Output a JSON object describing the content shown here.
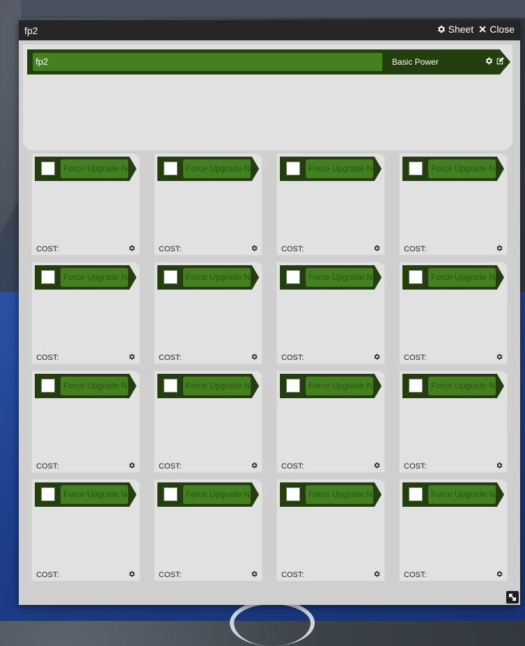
{
  "window": {
    "title": "fp2",
    "sheet_label": "Sheet",
    "close_label": "Close"
  },
  "power": {
    "name": "fp2",
    "type": "Basic Power"
  },
  "upgrades": {
    "placeholder": "Force Upgrade Name",
    "cost_label": "COST:",
    "rows": 4,
    "columns": 4
  },
  "colors": {
    "header_dark_green": "#243f0e",
    "field_green": "#43801f",
    "card_bg": "#e1e1e1",
    "titlebar": "#262626"
  },
  "icons": {
    "sheet": "gear-icon",
    "close": "x-icon",
    "power_settings": "gear-icon",
    "power_edit": "edit-icon",
    "upgrade_settings": "gear-icon",
    "resize": "resize-icon"
  }
}
